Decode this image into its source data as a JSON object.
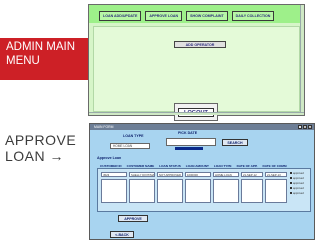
{
  "captions": {
    "admin_line1": "ADMIN MAIN",
    "admin_line2": "MENU",
    "approve_line1": "APPROVE",
    "approve_line2": "LOAN →"
  },
  "admin_screen": {
    "tabs": [
      "LOAN ADD/UPDATE",
      "APPROVE LOAN",
      "SHOW COMPLAINT",
      "DAILY COLLECTION"
    ],
    "add_operator_label": "ADD OPERATOR",
    "logout_label": "LOGOUT"
  },
  "approve_screen": {
    "window_title": "MAIN FORM",
    "window_controls": [
      "_",
      "□",
      "x"
    ],
    "loan_type_label": "LOAN TYPE",
    "loan_type_value": "HOME LOAN",
    "pick_date_label": "PICK DATE",
    "search_label": "SEARCH",
    "section_label": "Approve Loan",
    "columns": [
      "CUSTOMER ID",
      "CUSTOMER NAME",
      "LOAN STATUS",
      "LOAN AMOUNT",
      "LOAN TYPE",
      "DATE OF APP.",
      "DATE OF COMM"
    ],
    "row": [
      "4523",
      "SHELLY DIXIT/MAN",
      "NOT APPROVED",
      "1000000",
      "HOME LOAN",
      "21-SEP-12",
      "21-SEP-13"
    ],
    "checkboxes": [
      "approved",
      "approved",
      "approved",
      "approved",
      "approved"
    ],
    "approve_label": "APPROVE",
    "back_label": "<-BACK"
  }
}
